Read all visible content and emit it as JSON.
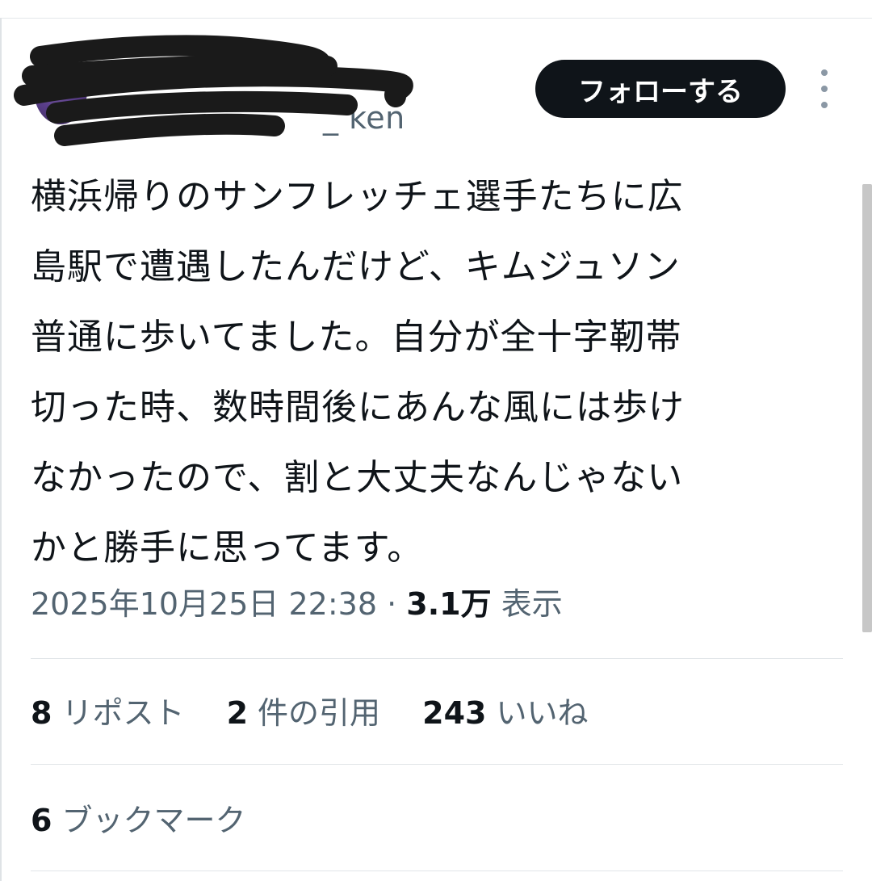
{
  "author": {
    "handle_visible": "_ ken"
  },
  "follow_button_label": "フォローする",
  "tweet": {
    "text_lines": [
      "横浜帰りのサンフレッチェ選手たちに広",
      "島駅で遭遇したんだけど、キムジュソン",
      "普通に歩いてました。自分が全十字靭帯",
      "切った時、数時間後にあんな風には歩け",
      "なかったので、割と大丈夫なんじゃない",
      "かと勝手に思ってます。"
    ],
    "timestamp": "2025年10月25日 22:38",
    "separator": "·",
    "views_count": "3.1万",
    "views_label": "表示"
  },
  "stats": {
    "reposts": {
      "count": "8",
      "label": "リポスト"
    },
    "quotes": {
      "count": "2",
      "label": "件の引用"
    },
    "likes": {
      "count": "243",
      "label": "いいね"
    },
    "bookmarks": {
      "count": "6",
      "label": "ブックマーク"
    }
  },
  "colors": {
    "text_primary": "#0f1419",
    "text_secondary": "#536471",
    "button_bg": "#0f1419",
    "button_text": "#ffffff",
    "divider": "#e1e5e8"
  }
}
